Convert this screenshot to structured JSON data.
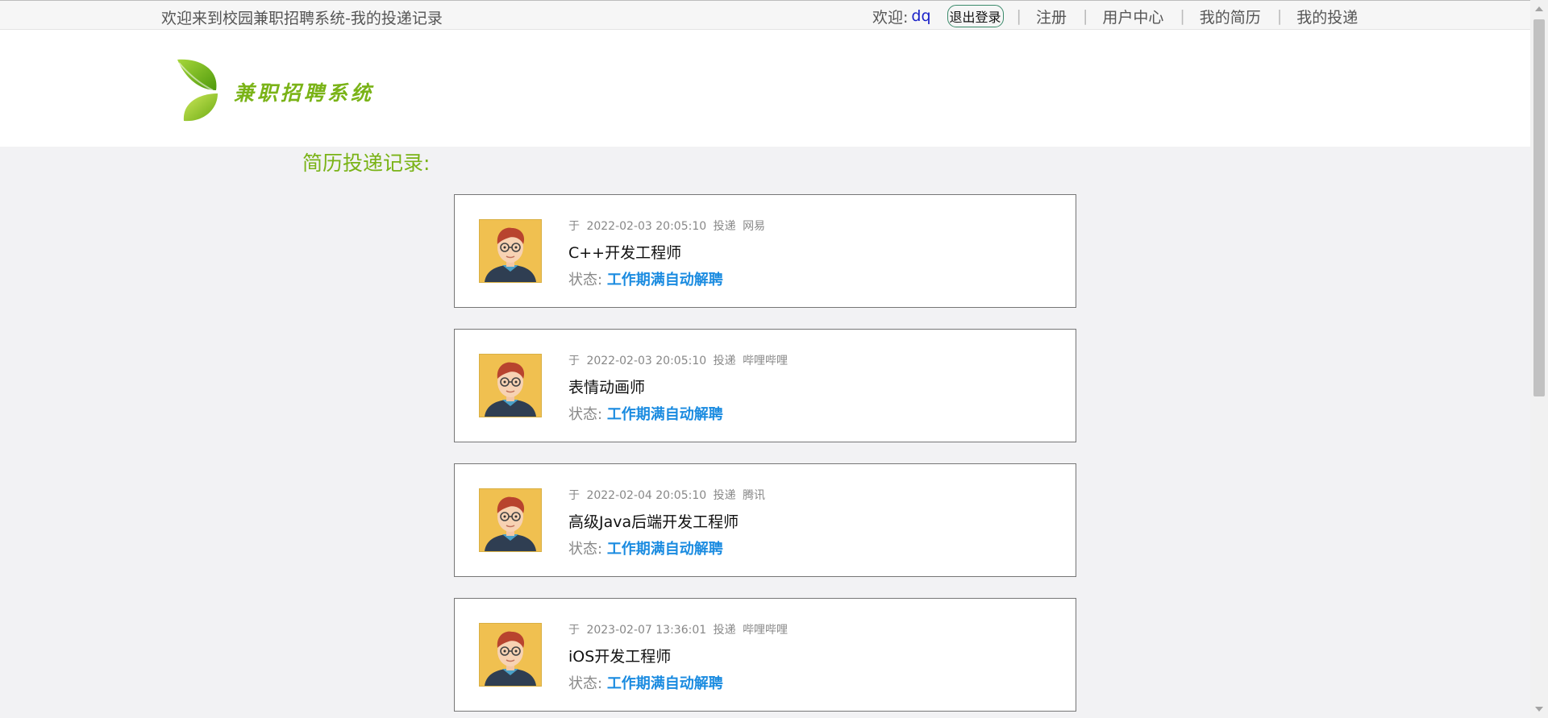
{
  "topbar": {
    "welcome_text": "欢迎来到校园兼职招聘系统-我的投递记录",
    "greet_label": "欢迎:",
    "username": "dq",
    "logout_label": "退出登录",
    "separator": "|",
    "nav": [
      "注册",
      "用户中心",
      "我的简历",
      "我的投递"
    ]
  },
  "header": {
    "logo_text": "兼职招聘系统",
    "logo_icon": "green-leaf-icon"
  },
  "page": {
    "section_title": "简历投递记录:"
  },
  "records": [
    {
      "prefix": "于",
      "datetime": "2022-02-03 20:05:10",
      "action": "投递",
      "company": "网易",
      "job_title": "C++开发工程师",
      "status_label": "状态:",
      "status_value": "工作期满自动解聘"
    },
    {
      "prefix": "于",
      "datetime": "2022-02-03 20:05:10",
      "action": "投递",
      "company": "哔哩哔哩",
      "job_title": "表情动画师",
      "status_label": "状态:",
      "status_value": "工作期满自动解聘"
    },
    {
      "prefix": "于",
      "datetime": "2022-02-04 20:05:10",
      "action": "投递",
      "company": "腾讯",
      "job_title": "高级Java后端开发工程师",
      "status_label": "状态:",
      "status_value": "工作期满自动解聘"
    },
    {
      "prefix": "于",
      "datetime": "2023-02-07 13:36:01",
      "action": "投递",
      "company": "哔哩哔哩",
      "job_title": "iOS开发工程师",
      "status_label": "状态:",
      "status_value": "工作期满自动解聘"
    }
  ],
  "colors": {
    "brand_green": "#7ab317",
    "status_blue": "#1a8be0",
    "username_blue": "#1a22c8",
    "avatar_bg": "#f0c050"
  }
}
